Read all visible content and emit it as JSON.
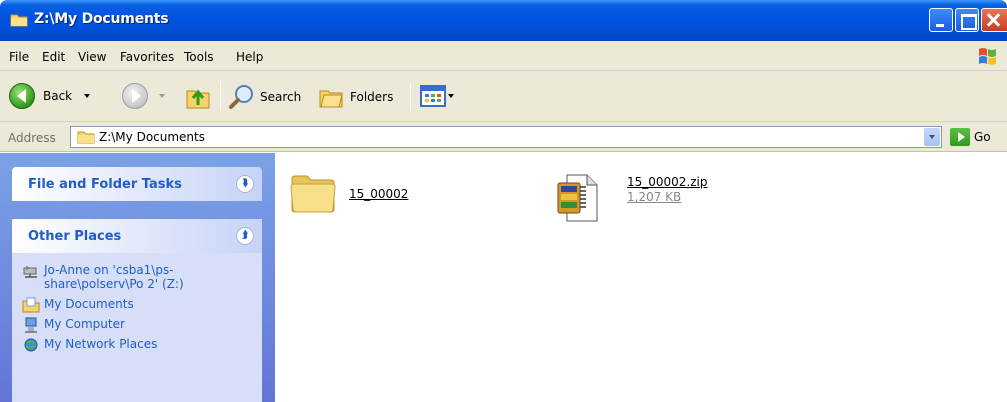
{
  "window": {
    "title": "Z:\\My Documents"
  },
  "menu": [
    "File",
    "Edit",
    "View",
    "Favorites",
    "Tools",
    "Help"
  ],
  "toolbar": {
    "back_label": "Back",
    "search_label": "Search",
    "folders_label": "Folders"
  },
  "address": {
    "label": "Address",
    "value": "Z:\\My Documents",
    "go_label": "Go"
  },
  "tasks": {
    "file_folder_tasks": "File and Folder Tasks",
    "other_places": "Other Places",
    "places": [
      {
        "label": "Jo-Anne on 'csba1\\ps-share\\polserv\\Po 2' (Z:)",
        "icon": "network-drive-icon"
      },
      {
        "label": "My Documents",
        "icon": "my-documents-icon"
      },
      {
        "label": "My Computer",
        "icon": "my-computer-icon"
      },
      {
        "label": "My Network Places",
        "icon": "network-places-icon"
      }
    ]
  },
  "files": [
    {
      "name": "15_00002",
      "type": "folder",
      "icon": "folder-icon"
    },
    {
      "name": "15_00002.zip",
      "size": "1,207 KB",
      "type": "zip",
      "icon": "zip-file-icon"
    }
  ],
  "colors": {
    "titlebar": "#0054e3",
    "taskpane": "#6375d6",
    "link": "#215dc6",
    "chrome": "#ece9d8"
  }
}
